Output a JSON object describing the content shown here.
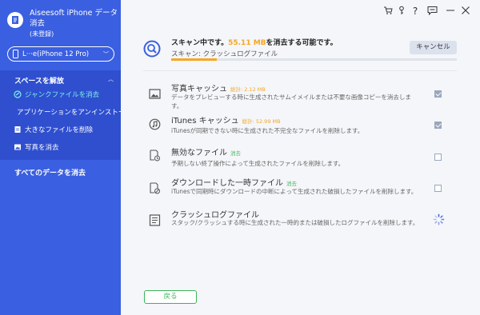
{
  "app": {
    "title_line1": "Aiseesoft iPhone データ",
    "title_line2": "消去",
    "status": "(未登録)"
  },
  "device": {
    "name": "L···e(iPhone 12 Pro)"
  },
  "sidebar": {
    "section_title": "スペースを解放",
    "items": [
      {
        "label": "ジャンクファイルを消去",
        "icon": "broom-icon",
        "active": true
      },
      {
        "label": "アプリケーションをアンインストー",
        "icon": "app-icon",
        "active": false
      },
      {
        "label": "大きなファイルを削除",
        "icon": "file-icon",
        "active": false
      },
      {
        "label": "写真を消去",
        "icon": "photo-icon",
        "active": false
      }
    ],
    "erase_all": "すべてのデータを消去"
  },
  "colors": {
    "sidebar": "#3a5fe0",
    "accent": "#f6a623",
    "green": "#3cb55a",
    "orange": "#f6a623"
  },
  "scan": {
    "title_prefix": "スキャン中です。",
    "size": "55.11 MB",
    "title_suffix": "を消去する可能です。",
    "subtitle": "スキャン: クラッシュログファイル",
    "progress": 0.16,
    "cancel": "キャンセル"
  },
  "items": [
    {
      "title": "写真キャッシュ",
      "badge": "総計: 2.12 MB",
      "desc": "データをプレビューする時に生成されたサムイメイルまたは不要な画像コピーを消去します。",
      "checked": true,
      "icon": "image-icon"
    },
    {
      "title": "iTunes キャッシュ",
      "badge": "総計: 52.99 MB",
      "desc": "iTunesが同期できない時に生成された不完全なファイルを削除します。",
      "checked": true,
      "icon": "music-icon"
    },
    {
      "title": "無効なファイル",
      "badge": "消去",
      "desc": "予期しない終了操作によって生成されたファイルを削除します。",
      "checked": false,
      "icon": "invalid-file-icon"
    },
    {
      "title": "ダウンロードした一時ファイル",
      "badge": "消去",
      "desc": "iTunesで同期時にダウンロードの中断によって生成された破損したファイルを削除します。",
      "checked": false,
      "icon": "download-icon"
    },
    {
      "title": "クラッシュログファイル",
      "badge": "",
      "desc": "スタック/クラッシュする時に生成された一時的または破損したログファイルを削除します。",
      "checked": false,
      "icon": "log-icon"
    }
  ],
  "back": "戻る"
}
